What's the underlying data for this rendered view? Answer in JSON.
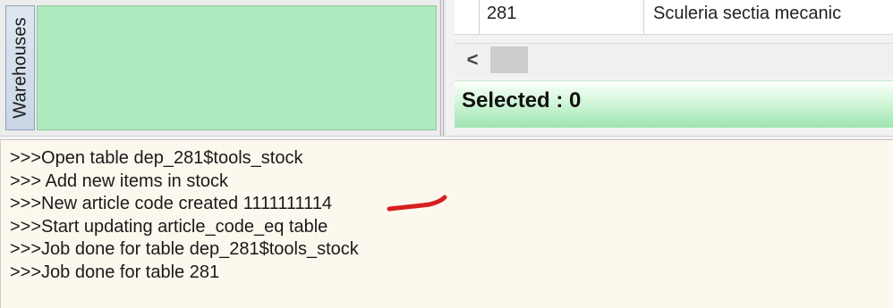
{
  "warehouses": {
    "tab_label": "Warehouses"
  },
  "grid": {
    "row": {
      "id": "281",
      "name": "Sculeria sectia mecanic"
    }
  },
  "scrollbar": {
    "left_arrow": "<"
  },
  "status": {
    "selected_text": "Selected : 0"
  },
  "log": {
    "lines": [
      ">>>Open table dep_281$tools_stock",
      ">>> Add new items in stock",
      ">>>New article code created 1111111114",
      ">>>Start updating article_code_eq table",
      ">>>Job done for table dep_281$tools_stock",
      ">>>Job done for table 281"
    ]
  },
  "colors": {
    "warehouse_panel": "#aeeabf",
    "status_gradient_end": "#9fe5b0",
    "log_background": "#fdf8ee",
    "annotation_mark": "#d6201f"
  }
}
